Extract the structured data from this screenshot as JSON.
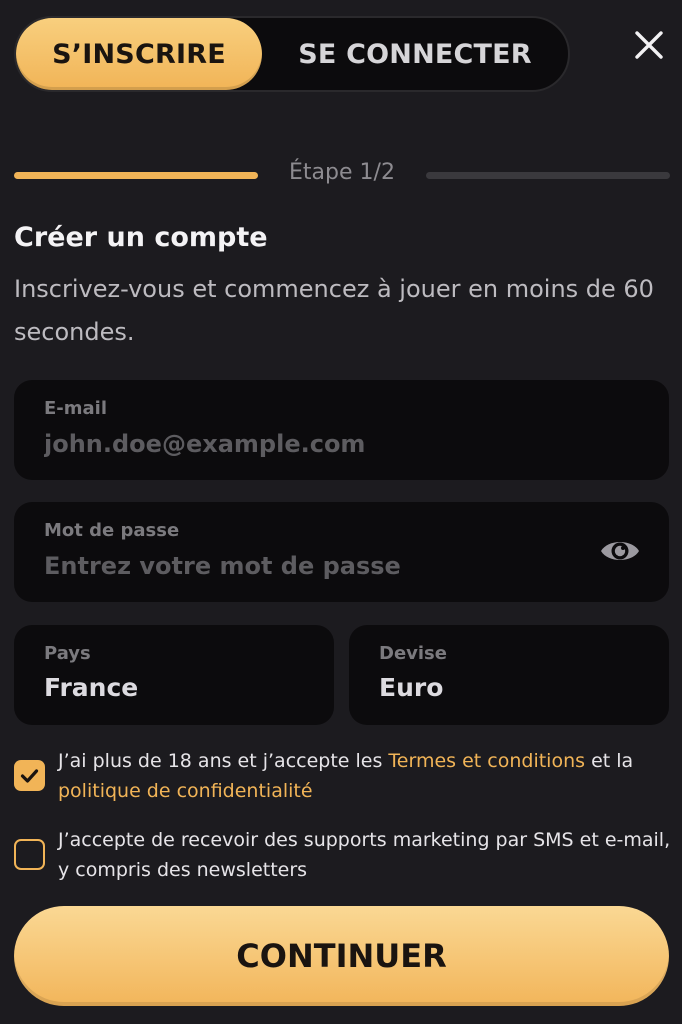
{
  "tabs": {
    "signup": "S’INSCRIRE",
    "login": "SE CONNECTER"
  },
  "step": {
    "label": "Étape 1/2",
    "progress_fraction": 0.5
  },
  "form": {
    "title": "Créer un compte",
    "subtitle": "Inscrivez-vous et commencez à jouer en moins de 60 secondes.",
    "email": {
      "label": "E-mail",
      "placeholder": "john.doe@example.com",
      "value": ""
    },
    "password": {
      "label": "Mot de passe",
      "placeholder": "Entrez votre mot de passe",
      "value": ""
    },
    "country": {
      "label": "Pays",
      "value": "France"
    },
    "currency": {
      "label": "Devise",
      "value": "Euro"
    }
  },
  "consent": {
    "terms": {
      "checked": true,
      "prefix": "J’ai plus de 18 ans et j’accepte les ",
      "terms_link": "Termes et conditions",
      "middle": " et la ",
      "privacy_link": "politique de confidentialité"
    },
    "marketing": {
      "checked": false,
      "text": "J’accepte de recevoir des supports marketing par SMS et e-mail, y compris des newsletters"
    }
  },
  "actions": {
    "continue": "CONTINUER"
  },
  "colors": {
    "accent": "#f1b457",
    "background": "#1c1b1f",
    "field": "#0c0b0d"
  },
  "icons": {
    "close": "close-icon",
    "eye": "eye-icon",
    "check": "checkmark-icon"
  }
}
